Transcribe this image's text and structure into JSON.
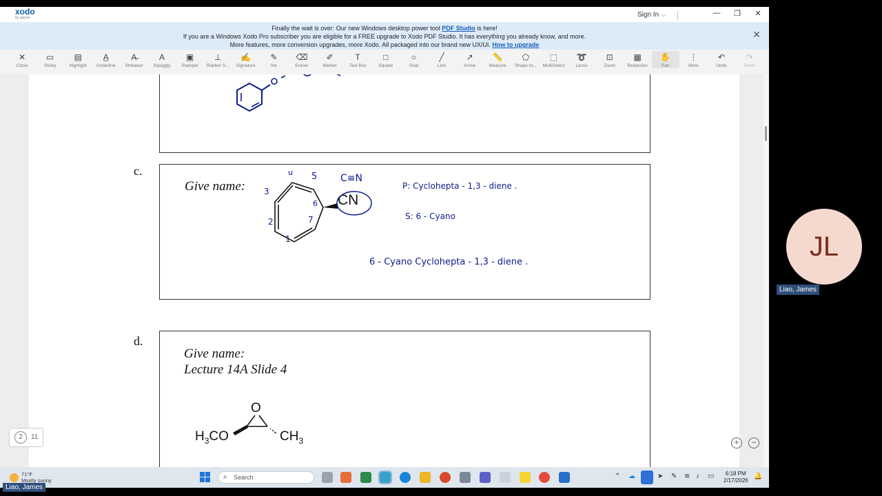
{
  "app": {
    "logo": "xodo",
    "logo_sub": "by apryse",
    "sign_in": "Sign In",
    "window_controls": [
      "—",
      "❐",
      "✕"
    ]
  },
  "banner": {
    "line1_pre": "Finally the wait is over: Our new Windows desktop power tool ",
    "line1_link": "PDF Studio",
    "line1_post": " is here!",
    "line2": "If you are a Windows Xodo Pro subscriber you are eligible for a FREE upgrade to Xodo PDF Studio. It has everything you already know, and more.",
    "line3_pre": "More features, more conversion upgrades, more Xodo. All packaged into our brand new UX/UI. ",
    "line3_link": "How to upgrade"
  },
  "toolbar": [
    {
      "label": "Close",
      "icon": "close-icon",
      "glyph": "✕"
    },
    {
      "label": "Sticky",
      "icon": "sticky-note-icon",
      "glyph": "▭"
    },
    {
      "label": "Highlight",
      "icon": "highlight-icon",
      "glyph": "▤"
    },
    {
      "label": "Underline",
      "icon": "underline-icon",
      "glyph": "A̲"
    },
    {
      "label": "Strikeout",
      "icon": "strikeout-icon",
      "glyph": "A̶"
    },
    {
      "label": "Squiggly",
      "icon": "squiggly-icon",
      "glyph": "A"
    },
    {
      "label": "Stamper",
      "icon": "stamper-icon",
      "glyph": "▣"
    },
    {
      "label": "Rubber S...",
      "icon": "rubber-stamp-icon",
      "glyph": "⊥"
    },
    {
      "label": "Signature",
      "icon": "signature-icon",
      "glyph": "✍"
    },
    {
      "label": "Ink",
      "icon": "ink-pen-icon",
      "glyph": "✎"
    },
    {
      "label": "Eraser",
      "icon": "eraser-icon",
      "glyph": "⌫"
    },
    {
      "label": "Marker",
      "icon": "marker-icon",
      "glyph": "✐"
    },
    {
      "label": "Text Box",
      "icon": "text-box-icon",
      "glyph": "T"
    },
    {
      "label": "Square",
      "icon": "square-icon",
      "glyph": "□"
    },
    {
      "label": "Oval",
      "icon": "oval-icon",
      "glyph": "○"
    },
    {
      "label": "Line",
      "icon": "line-icon",
      "glyph": "╱"
    },
    {
      "label": "Arrow",
      "icon": "arrow-icon",
      "glyph": "↗"
    },
    {
      "label": "Measure",
      "icon": "measure-icon",
      "glyph": "📏"
    },
    {
      "label": "Shape to...",
      "icon": "shape-icon",
      "glyph": "⬠"
    },
    {
      "label": "MultiSelect",
      "icon": "multiselect-icon",
      "glyph": "⬚"
    },
    {
      "label": "Lasso",
      "icon": "lasso-icon",
      "glyph": "➰"
    },
    {
      "label": "Zoom",
      "icon": "zoom-icon",
      "glyph": "⊡"
    },
    {
      "label": "Redaction",
      "icon": "redaction-icon",
      "glyph": "▦"
    },
    {
      "label": "Pan",
      "icon": "pan-hand-icon",
      "glyph": "✋",
      "active": true
    },
    {
      "label": "More",
      "icon": "more-icon",
      "glyph": "⋮"
    },
    {
      "label": "Undo",
      "icon": "undo-icon",
      "glyph": "↶"
    },
    {
      "label": "Redo",
      "icon": "redo-icon",
      "glyph": "↷",
      "disabled": true
    }
  ],
  "document": {
    "section_c": {
      "letter": "c.",
      "prompt": "Give name:",
      "nitrile_label": "CN",
      "notes": {
        "num_u": "u",
        "num_5": "5",
        "num_3": "3",
        "num_6": "6",
        "num_2": "2",
        "num_7": "7",
        "num_1": "1",
        "cen": "C≡N",
        "parent": "P:  Cyclohepta - 1,3 - diene .",
        "sub": "S:  6 - Cyano",
        "answer": "6 - Cyano Cyclohepta - 1,3 - diene ."
      }
    },
    "section_d": {
      "letter": "d.",
      "prompt": "Give name:",
      "reference": "Lecture 14A Slide 4",
      "oxygen": "O",
      "left_group": "H",
      "left_sub": "3",
      "left_rest": "CO",
      "right_group": "CH",
      "right_sub": "3"
    },
    "page_current": "2",
    "page_total": "11",
    "zoom_in": "+",
    "zoom_out": "−"
  },
  "participant": {
    "initials": "JL",
    "name": "Liao, James",
    "avatar_color": "#f5d9cf"
  },
  "taskbar": {
    "weather_temp": "71°F",
    "weather_desc": "Mostly sunny",
    "search_placeholder": "Search",
    "time": "6:18 PM",
    "date": "2/17/2026"
  },
  "presenter_label": "Liao, James"
}
